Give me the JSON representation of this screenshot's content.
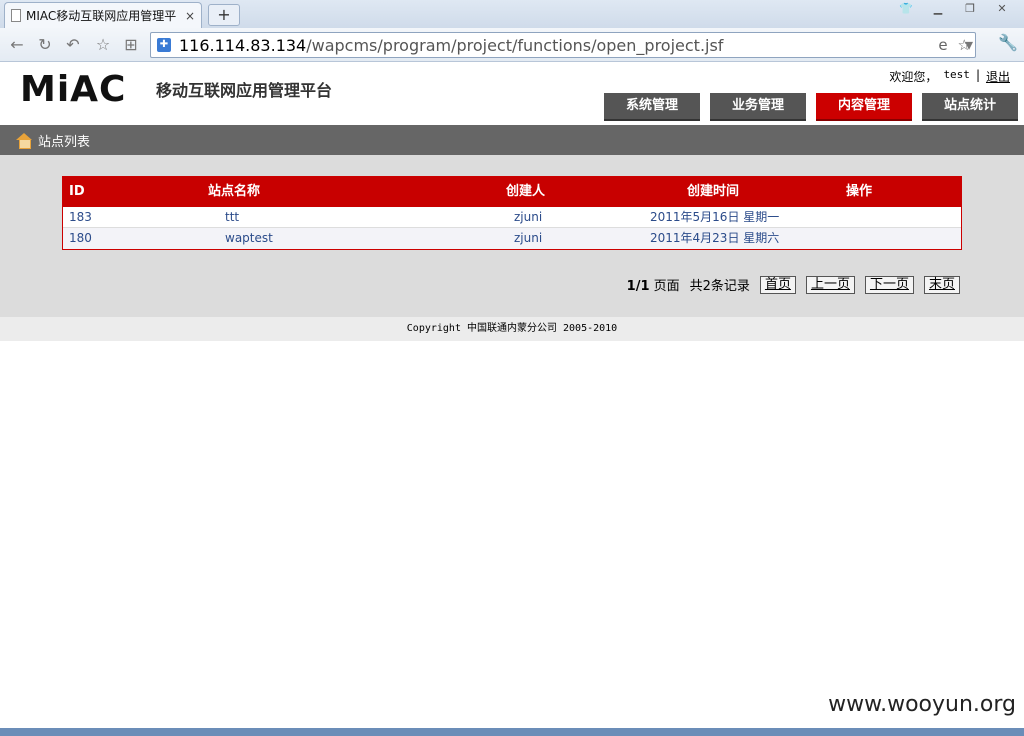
{
  "browser": {
    "tab_title": "MIAC移动互联网应用管理平",
    "tab_close": "×",
    "new_tab": "+",
    "url_host": "116.114.83.134",
    "url_path": "/wapcms/program/project/functions/open_project.jsf"
  },
  "header": {
    "logo": "MiAC",
    "brand": "移动互联网应用管理平台",
    "welcome": "欢迎您，",
    "user": "test",
    "separator": "|",
    "logout": "退出",
    "menu": [
      "系统管理",
      "业务管理",
      "内容管理",
      "站点统计"
    ],
    "active_menu": "内容管理"
  },
  "breadcrumb": {
    "label": "站点列表"
  },
  "table": {
    "columns": [
      "ID",
      "站点名称",
      "创建人",
      "创建时间",
      "操作"
    ],
    "rows": [
      {
        "id": "183",
        "name": "ttt",
        "creator": "zjuni",
        "created": "2011年5月16日 星期一",
        "action": ""
      },
      {
        "id": "180",
        "name": "waptest",
        "creator": "zjuni",
        "created": "2011年4月23日 星期六",
        "action": ""
      }
    ]
  },
  "pager": {
    "page": "1/1",
    "page_label": "页面",
    "total": "共2条记录",
    "first": "首页",
    "prev": "上一页",
    "next": "下一页",
    "last": "末页"
  },
  "footer": {
    "copyright": "Copyright 中国联通内蒙分公司 2005-2010"
  },
  "watermark": "www.wooyun.org",
  "colors": {
    "accent": "#c80000",
    "menu": "#555555",
    "crumb": "#666666"
  }
}
